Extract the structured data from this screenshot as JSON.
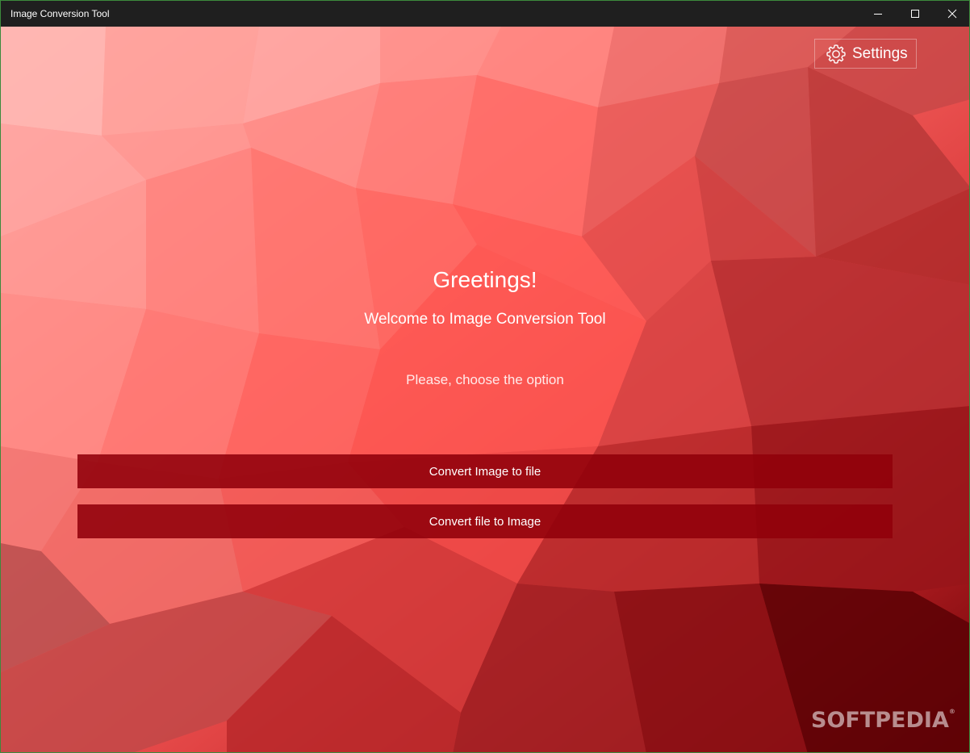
{
  "window": {
    "title": "Image Conversion Tool"
  },
  "header": {
    "settings_label": "Settings"
  },
  "main": {
    "greeting": "Greetings!",
    "welcome": "Welcome to Image Conversion Tool",
    "prompt": "Please, choose the option",
    "buttons": {
      "image_to_file": "Convert Image to file",
      "file_to_image": "Convert file to Image"
    }
  },
  "watermark": {
    "text": "SOFTPEDIA",
    "mark": "®"
  },
  "icons": {
    "settings": "gear-icon",
    "minimize": "minimize-icon",
    "maximize": "maximize-icon",
    "close": "close-icon"
  },
  "colors": {
    "titlebar": "#1f1f1f",
    "accent": "#e84a4a",
    "button": "#91000a"
  }
}
